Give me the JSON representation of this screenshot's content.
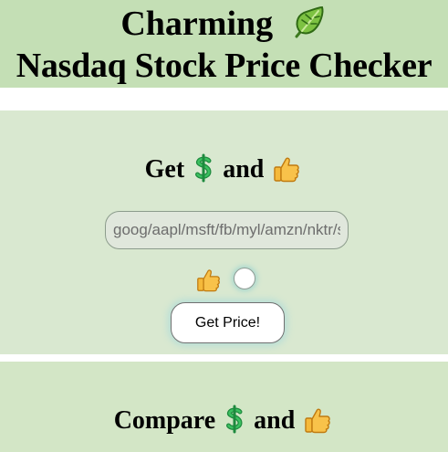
{
  "header": {
    "title_line1": "Charming",
    "title_line2": "Nasdaq Stock Price Checker",
    "title_icon": "leafy-greens-icon"
  },
  "get_panel": {
    "title_prefix": "Get",
    "title_and": "and",
    "icons": [
      "dollar-sign-icon",
      "thumbs-up-icon"
    ],
    "input": {
      "placeholder": "goog/aapl/msft/fb/myl/amzn/nktr/s",
      "value": ""
    },
    "like_icon": "thumbs-up-icon",
    "like_checked": false,
    "button_label": "Get Price!"
  },
  "compare_panel": {
    "title_prefix": "Compare",
    "title_and": "and",
    "icons": [
      "dollar-sign-icon",
      "thumbs-up-icon"
    ]
  },
  "colors": {
    "header_bg": "#c4dfb5",
    "panel_bg": "#d9e8d0",
    "panel2_bg": "#d3e6c6",
    "dollar_green": "#2fa84f",
    "thumb_yellow": "#f5b93a"
  }
}
